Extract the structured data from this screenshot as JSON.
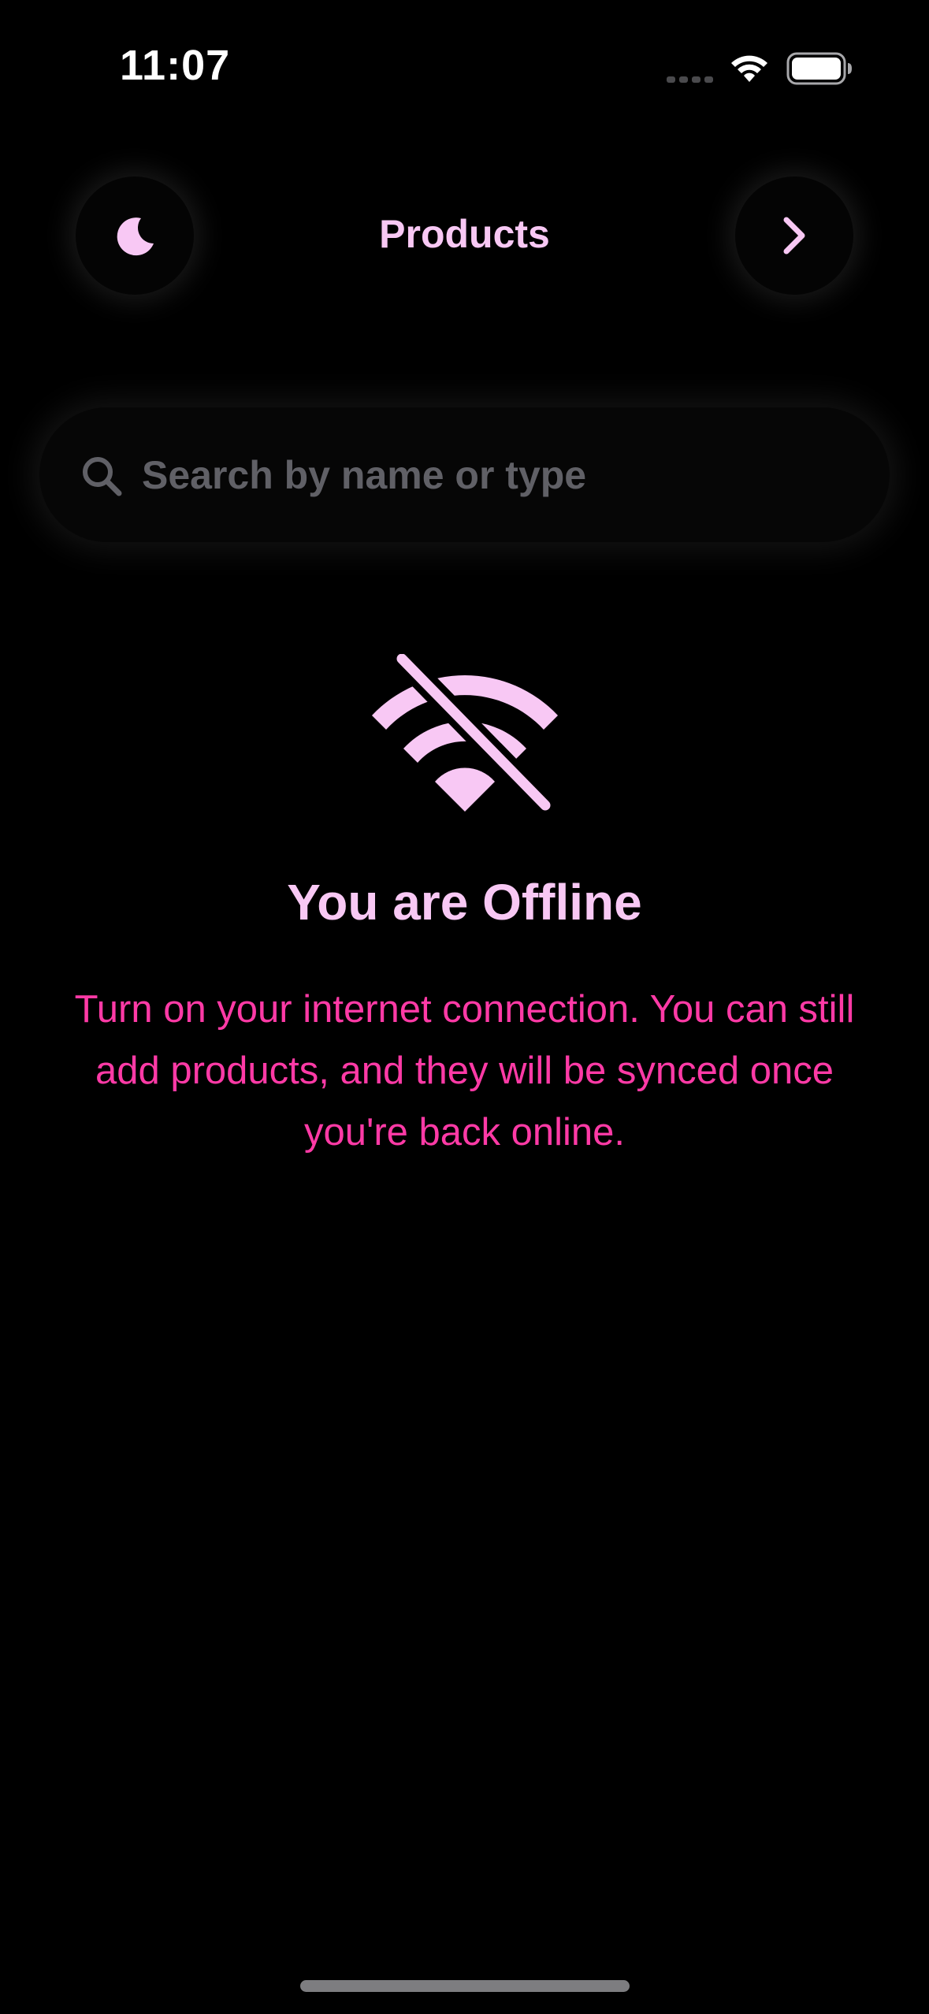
{
  "status_bar": {
    "time": "11:07"
  },
  "header": {
    "title": "Products",
    "left_icon": "moon-icon",
    "right_icon": "chevron-right-icon"
  },
  "search": {
    "placeholder": "Search by name or type",
    "value": "",
    "icon": "search-icon"
  },
  "offline": {
    "icon": "wifi-off-icon",
    "title": "You are Offline",
    "message": "Turn on your internet connection. You can still add products, and they will be synced once you're back online."
  },
  "colors": {
    "background": "#000000",
    "accent_light": "#f8c8f4",
    "accent_pink": "#ff3aa6",
    "placeholder": "#606066"
  }
}
